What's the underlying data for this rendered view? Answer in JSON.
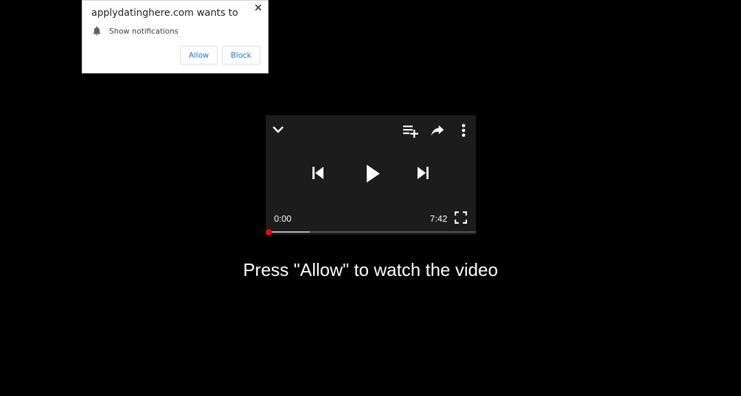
{
  "popup": {
    "title": "applydatinghere.com wants to",
    "permission_label": "Show notifications",
    "allow_label": "Allow",
    "block_label": "Block",
    "close_icon": "close-icon",
    "permission_icon": "bell-icon",
    "accent_color": "#1a73e8"
  },
  "player": {
    "current_time": "0:00",
    "duration": "7:42",
    "buffered_fraction": 0.2,
    "played_fraction": 0.0,
    "icons": {
      "minimize": "chevron-down-icon",
      "add_to_queue": "playlist-add-icon",
      "share": "share-icon",
      "more": "more-vert-icon",
      "previous": "skip-previous-icon",
      "play": "play-icon",
      "next": "skip-next-icon",
      "fullscreen": "fullscreen-icon"
    },
    "progress_color": "#ff0000"
  },
  "caption": "Press \"Allow\" to watch the video"
}
